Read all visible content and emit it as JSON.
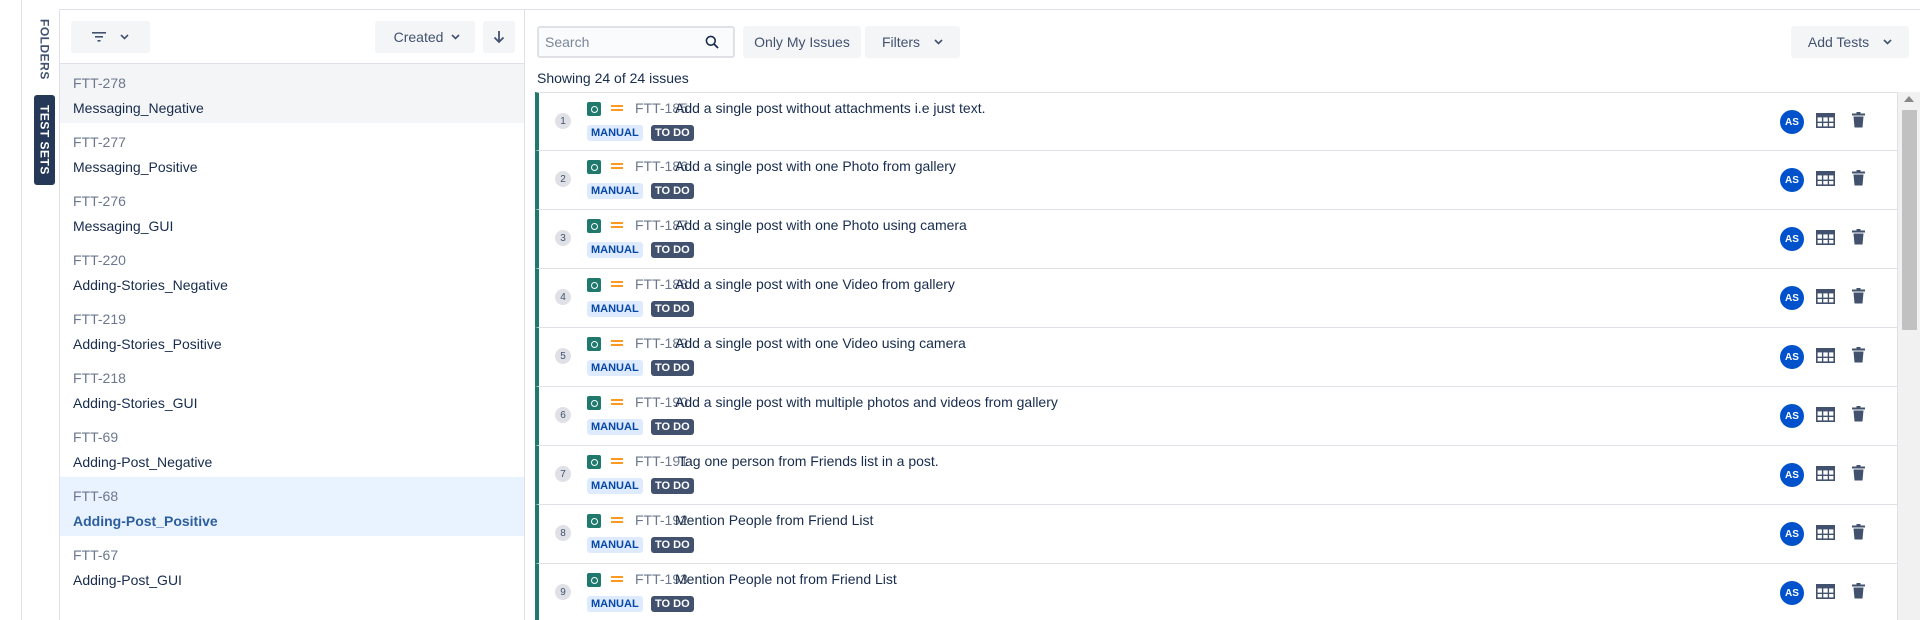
{
  "vertical_tabs": {
    "folders": "FOLDERS",
    "test_sets": "TEST SETS"
  },
  "sets_panel": {
    "sort_field": "Created",
    "items": [
      {
        "key": "FTT-278",
        "name": "Messaging_Negative"
      },
      {
        "key": "FTT-277",
        "name": "Messaging_Positive"
      },
      {
        "key": "FTT-276",
        "name": "Messaging_GUI"
      },
      {
        "key": "FTT-220",
        "name": "Adding-Stories_Negative"
      },
      {
        "key": "FTT-219",
        "name": "Adding-Stories_Positive"
      },
      {
        "key": "FTT-218",
        "name": "Adding-Stories_GUI"
      },
      {
        "key": "FTT-69",
        "name": "Adding-Post_Negative"
      },
      {
        "key": "FTT-68",
        "name": "Adding-Post_Positive"
      },
      {
        "key": "FTT-67",
        "name": "Adding-Post_GUI"
      }
    ]
  },
  "toolbar": {
    "search_placeholder": "Search",
    "only_my_issues": "Only My Issues",
    "filters": "Filters",
    "add_tests": "Add Tests"
  },
  "results_count": "Showing 24 of 24 issues",
  "issues": [
    {
      "rank": "1",
      "key": "FTT-185",
      "summary": "Add a single post without attachments i.e just text.",
      "type": "MANUAL",
      "status": "TO DO",
      "assignee": "AS"
    },
    {
      "rank": "2",
      "key": "FTT-186",
      "summary": "Add a single post with one Photo from gallery",
      "type": "MANUAL",
      "status": "TO DO",
      "assignee": "AS"
    },
    {
      "rank": "3",
      "key": "FTT-187",
      "summary": "Add a single post with one Photo using camera",
      "type": "MANUAL",
      "status": "TO DO",
      "assignee": "AS"
    },
    {
      "rank": "4",
      "key": "FTT-188",
      "summary": "Add a single post with one Video from gallery",
      "type": "MANUAL",
      "status": "TO DO",
      "assignee": "AS"
    },
    {
      "rank": "5",
      "key": "FTT-189",
      "summary": "Add a single post with one Video using camera",
      "type": "MANUAL",
      "status": "TO DO",
      "assignee": "AS"
    },
    {
      "rank": "6",
      "key": "FTT-190",
      "summary": "Add a single post with multiple photos and videos from gallery",
      "type": "MANUAL",
      "status": "TO DO",
      "assignee": "AS"
    },
    {
      "rank": "7",
      "key": "FTT-191",
      "summary": "Tag one person from Friends list in a post.",
      "type": "MANUAL",
      "status": "TO DO",
      "assignee": "AS"
    },
    {
      "rank": "8",
      "key": "FTT-192",
      "summary": "Mention People from Friend List",
      "type": "MANUAL",
      "status": "TO DO",
      "assignee": "AS"
    },
    {
      "rank": "9",
      "key": "FTT-193",
      "summary": "Mention People not from Friend List",
      "type": "MANUAL",
      "status": "TO DO",
      "assignee": "AS"
    }
  ],
  "colors": {
    "accent": "#1f7a6d",
    "avatar": "#0052cc",
    "priority": "#ff991f",
    "selected_bg": "#e9f2ff"
  }
}
